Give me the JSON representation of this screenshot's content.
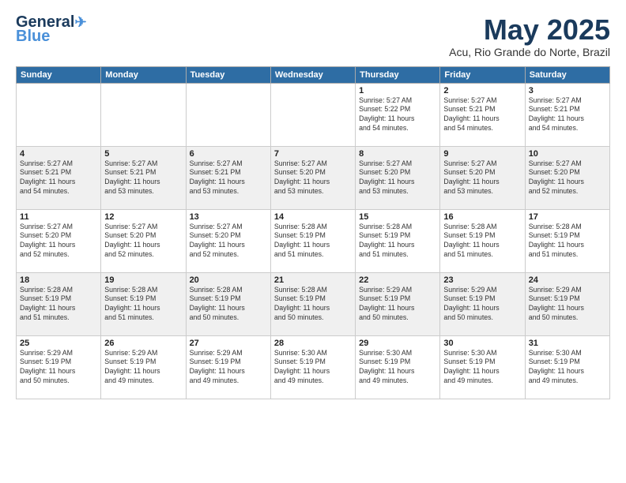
{
  "header": {
    "logo_line1": "General",
    "logo_line2": "Blue",
    "month": "May 2025",
    "location": "Acu, Rio Grande do Norte, Brazil"
  },
  "weekdays": [
    "Sunday",
    "Monday",
    "Tuesday",
    "Wednesday",
    "Thursday",
    "Friday",
    "Saturday"
  ],
  "weeks": [
    [
      {
        "day": "",
        "info": ""
      },
      {
        "day": "",
        "info": ""
      },
      {
        "day": "",
        "info": ""
      },
      {
        "day": "",
        "info": ""
      },
      {
        "day": "1",
        "info": "Sunrise: 5:27 AM\nSunset: 5:22 PM\nDaylight: 11 hours\nand 54 minutes."
      },
      {
        "day": "2",
        "info": "Sunrise: 5:27 AM\nSunset: 5:21 PM\nDaylight: 11 hours\nand 54 minutes."
      },
      {
        "day": "3",
        "info": "Sunrise: 5:27 AM\nSunset: 5:21 PM\nDaylight: 11 hours\nand 54 minutes."
      }
    ],
    [
      {
        "day": "4",
        "info": "Sunrise: 5:27 AM\nSunset: 5:21 PM\nDaylight: 11 hours\nand 54 minutes."
      },
      {
        "day": "5",
        "info": "Sunrise: 5:27 AM\nSunset: 5:21 PM\nDaylight: 11 hours\nand 53 minutes."
      },
      {
        "day": "6",
        "info": "Sunrise: 5:27 AM\nSunset: 5:21 PM\nDaylight: 11 hours\nand 53 minutes."
      },
      {
        "day": "7",
        "info": "Sunrise: 5:27 AM\nSunset: 5:20 PM\nDaylight: 11 hours\nand 53 minutes."
      },
      {
        "day": "8",
        "info": "Sunrise: 5:27 AM\nSunset: 5:20 PM\nDaylight: 11 hours\nand 53 minutes."
      },
      {
        "day": "9",
        "info": "Sunrise: 5:27 AM\nSunset: 5:20 PM\nDaylight: 11 hours\nand 53 minutes."
      },
      {
        "day": "10",
        "info": "Sunrise: 5:27 AM\nSunset: 5:20 PM\nDaylight: 11 hours\nand 52 minutes."
      }
    ],
    [
      {
        "day": "11",
        "info": "Sunrise: 5:27 AM\nSunset: 5:20 PM\nDaylight: 11 hours\nand 52 minutes."
      },
      {
        "day": "12",
        "info": "Sunrise: 5:27 AM\nSunset: 5:20 PM\nDaylight: 11 hours\nand 52 minutes."
      },
      {
        "day": "13",
        "info": "Sunrise: 5:27 AM\nSunset: 5:20 PM\nDaylight: 11 hours\nand 52 minutes."
      },
      {
        "day": "14",
        "info": "Sunrise: 5:28 AM\nSunset: 5:19 PM\nDaylight: 11 hours\nand 51 minutes."
      },
      {
        "day": "15",
        "info": "Sunrise: 5:28 AM\nSunset: 5:19 PM\nDaylight: 11 hours\nand 51 minutes."
      },
      {
        "day": "16",
        "info": "Sunrise: 5:28 AM\nSunset: 5:19 PM\nDaylight: 11 hours\nand 51 minutes."
      },
      {
        "day": "17",
        "info": "Sunrise: 5:28 AM\nSunset: 5:19 PM\nDaylight: 11 hours\nand 51 minutes."
      }
    ],
    [
      {
        "day": "18",
        "info": "Sunrise: 5:28 AM\nSunset: 5:19 PM\nDaylight: 11 hours\nand 51 minutes."
      },
      {
        "day": "19",
        "info": "Sunrise: 5:28 AM\nSunset: 5:19 PM\nDaylight: 11 hours\nand 51 minutes."
      },
      {
        "day": "20",
        "info": "Sunrise: 5:28 AM\nSunset: 5:19 PM\nDaylight: 11 hours\nand 50 minutes."
      },
      {
        "day": "21",
        "info": "Sunrise: 5:28 AM\nSunset: 5:19 PM\nDaylight: 11 hours\nand 50 minutes."
      },
      {
        "day": "22",
        "info": "Sunrise: 5:29 AM\nSunset: 5:19 PM\nDaylight: 11 hours\nand 50 minutes."
      },
      {
        "day": "23",
        "info": "Sunrise: 5:29 AM\nSunset: 5:19 PM\nDaylight: 11 hours\nand 50 minutes."
      },
      {
        "day": "24",
        "info": "Sunrise: 5:29 AM\nSunset: 5:19 PM\nDaylight: 11 hours\nand 50 minutes."
      }
    ],
    [
      {
        "day": "25",
        "info": "Sunrise: 5:29 AM\nSunset: 5:19 PM\nDaylight: 11 hours\nand 50 minutes."
      },
      {
        "day": "26",
        "info": "Sunrise: 5:29 AM\nSunset: 5:19 PM\nDaylight: 11 hours\nand 49 minutes."
      },
      {
        "day": "27",
        "info": "Sunrise: 5:29 AM\nSunset: 5:19 PM\nDaylight: 11 hours\nand 49 minutes."
      },
      {
        "day": "28",
        "info": "Sunrise: 5:30 AM\nSunset: 5:19 PM\nDaylight: 11 hours\nand 49 minutes."
      },
      {
        "day": "29",
        "info": "Sunrise: 5:30 AM\nSunset: 5:19 PM\nDaylight: 11 hours\nand 49 minutes."
      },
      {
        "day": "30",
        "info": "Sunrise: 5:30 AM\nSunset: 5:19 PM\nDaylight: 11 hours\nand 49 minutes."
      },
      {
        "day": "31",
        "info": "Sunrise: 5:30 AM\nSunset: 5:19 PM\nDaylight: 11 hours\nand 49 minutes."
      }
    ]
  ]
}
